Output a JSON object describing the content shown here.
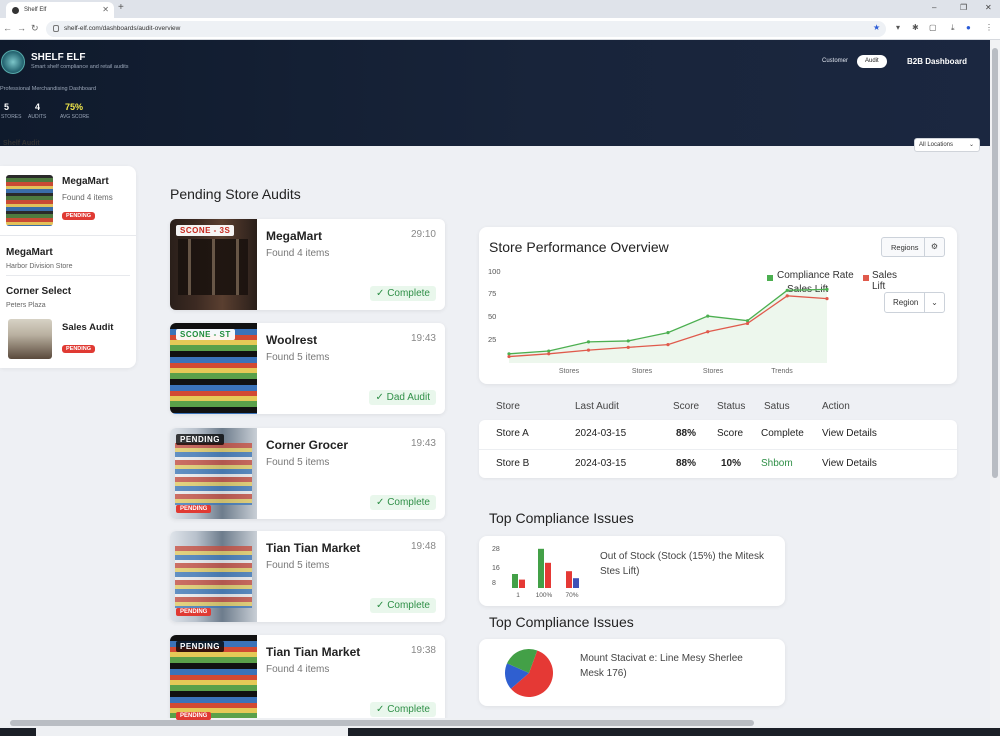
{
  "browser": {
    "tab_title": "Shelf Elf",
    "url": "shelf-elf.com/dashboards/audit-overview",
    "window_controls": [
      "–",
      "❐",
      "✕"
    ]
  },
  "hero": {
    "brand": "SHELF ELF",
    "brand_sub": "Smart shelf compliance and retail audits",
    "subtitle": "Professional Merchandising Dashboard",
    "stats": [
      {
        "value": "5",
        "label": "STORES"
      },
      {
        "value": "4",
        "label": "AUDITS"
      },
      {
        "value": "75%",
        "label": "AVG SCORE"
      }
    ],
    "toggle": [
      "Customer",
      "Audit"
    ],
    "dashboard_label": "B2B Dashboard"
  },
  "filter": {
    "label": "All Locations"
  },
  "sidebar": {
    "header": "Shelf Audit",
    "items": [
      {
        "title": "MegaMart",
        "sub": "Found 4 items",
        "badge": "PENDING"
      },
      {
        "title": "MegaMart",
        "sub": "Harbor Division Store"
      },
      {
        "title": "Corner Select",
        "sub": "Peters Plaza"
      },
      {
        "title": "Sales Audit",
        "badge": "PENDING"
      }
    ]
  },
  "pending": {
    "title": "Pending Store Audits",
    "cards": [
      {
        "title": "MegaMart",
        "sub": "Found 4 items",
        "time": "29:10",
        "status": "✓  Complete",
        "tag": "SCONE - 3S",
        "tag_style": "",
        "img": "img-bottles",
        "bottom": ""
      },
      {
        "title": "Woolrest",
        "sub": "Found 5 items",
        "time": "19:43",
        "status": "✓  Dad Audit",
        "tag": "SCONE - ST",
        "tag_style": "green",
        "img": "img-store",
        "bottom": ""
      },
      {
        "title": "Corner Grocer",
        "sub": "Found 5 items",
        "time": "19:43",
        "status": "✓  Complete",
        "tag": "PENDING",
        "tag_style": "dark",
        "img": "img-aisle",
        "bottom": "PENDING"
      },
      {
        "title": "Tian Tian Market",
        "sub": "Found 5 items",
        "time": "19:48",
        "status": "✓  Complete",
        "tag": "",
        "tag_style": "",
        "img": "img-aisle",
        "bottom": "PENDING"
      },
      {
        "title": "Tian Tian Market",
        "sub": "Found 4 items",
        "time": "19:38",
        "status": "✓  Complete",
        "tag": "PENDING",
        "tag_style": "dark",
        "img": "img-store",
        "bottom": "PENDING"
      }
    ]
  },
  "performance": {
    "title": "Store Performance Overview",
    "button": "Regions",
    "select": "Region",
    "legend": {
      "a": "Compliance Rate",
      "b": "Sales Lift",
      "b2": "Sales Lift"
    },
    "colors": {
      "compliance": "#4caf50",
      "sales": "#e05a4c"
    }
  },
  "chart_data": [
    {
      "type": "line",
      "title": "Store Performance Overview",
      "y_ticks": [
        "100",
        "75",
        "50",
        "25"
      ],
      "x_ticks": [
        "Stores",
        "Stores",
        "Stores",
        "Trends"
      ],
      "ylim": [
        0,
        100
      ],
      "x": [
        1,
        2,
        3,
        4,
        5,
        6,
        7,
        8,
        9
      ],
      "series": [
        {
          "name": "Compliance Rate",
          "values": [
            10,
            13,
            23,
            24,
            33,
            51,
            46,
            79,
            80
          ]
        },
        {
          "name": "Sales Lift",
          "values": [
            7,
            10,
            14,
            17,
            20,
            34,
            43,
            73,
            70
          ]
        }
      ],
      "legend_position": "top-right",
      "grid": false
    },
    {
      "type": "bar",
      "title": "Top Compliance Issues",
      "y_ticks": [
        "28",
        "16",
        "8"
      ],
      "x_ticks": [
        "1",
        "100%",
        "70%"
      ],
      "series": [
        {
          "name": "green",
          "values": [
            10,
            28,
            0
          ]
        },
        {
          "name": "red",
          "values": [
            6,
            18,
            12
          ]
        },
        {
          "name": "blue",
          "values": [
            0,
            0,
            7
          ]
        }
      ]
    },
    {
      "type": "pie",
      "slices": [
        {
          "color": "#e53935",
          "value": 58
        },
        {
          "color": "#2f5fd0",
          "value": 18
        },
        {
          "color": "#43a047",
          "value": 24
        }
      ]
    }
  ],
  "table": {
    "headers": [
      "Store",
      "Last Audit",
      "Score",
      "Status",
      "Satus",
      "Action"
    ],
    "rows": [
      [
        "Store A",
        "2024-03-15",
        "88%",
        "Score",
        "Complete",
        "View Details"
      ],
      [
        "Store B",
        "2024-03-15",
        "88%",
        "10%",
        "Shbom",
        "View Details"
      ]
    ]
  },
  "compliance": {
    "title1": "Top Compliance Issues",
    "text1": "Out of Stock (Stock (15%) the Mitesk Stes Lift)",
    "title2": "Top Compliance Issues",
    "text2": "Mount Stacivat e: Line Mesy Sherlee Mesk 176)"
  }
}
